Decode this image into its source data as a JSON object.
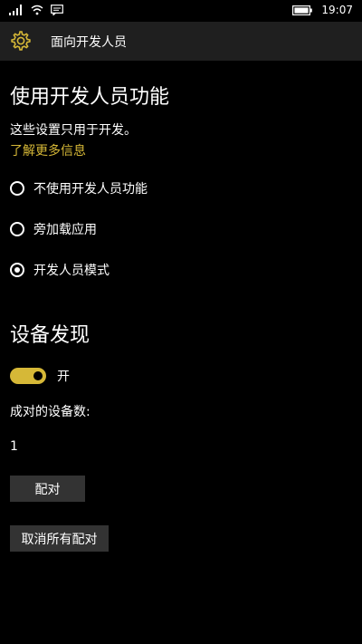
{
  "status_bar": {
    "time": "19:07",
    "icons": [
      "signal-icon",
      "wifi-icon",
      "message-icon",
      "battery-icon"
    ]
  },
  "header": {
    "title": "面向开发人员",
    "icon": "gear-icon"
  },
  "developer_section": {
    "title": "使用开发人员功能",
    "description": "这些设置只用于开发。",
    "learn_more": "了解更多信息",
    "options": [
      {
        "label": "不使用开发人员功能",
        "selected": false
      },
      {
        "label": "旁加载应用",
        "selected": false
      },
      {
        "label": "开发人员模式",
        "selected": true
      }
    ]
  },
  "discovery_section": {
    "title": "设备发现",
    "toggle_state": "开",
    "toggle_on": true,
    "paired_label": "成对的设备数:",
    "paired_count": "1",
    "pair_button": "配对",
    "unpair_all_button": "取消所有配对"
  },
  "colors": {
    "accent": "#d6b837",
    "background": "#000000",
    "header_bg": "#1f1f1f",
    "button_bg": "#333333"
  }
}
